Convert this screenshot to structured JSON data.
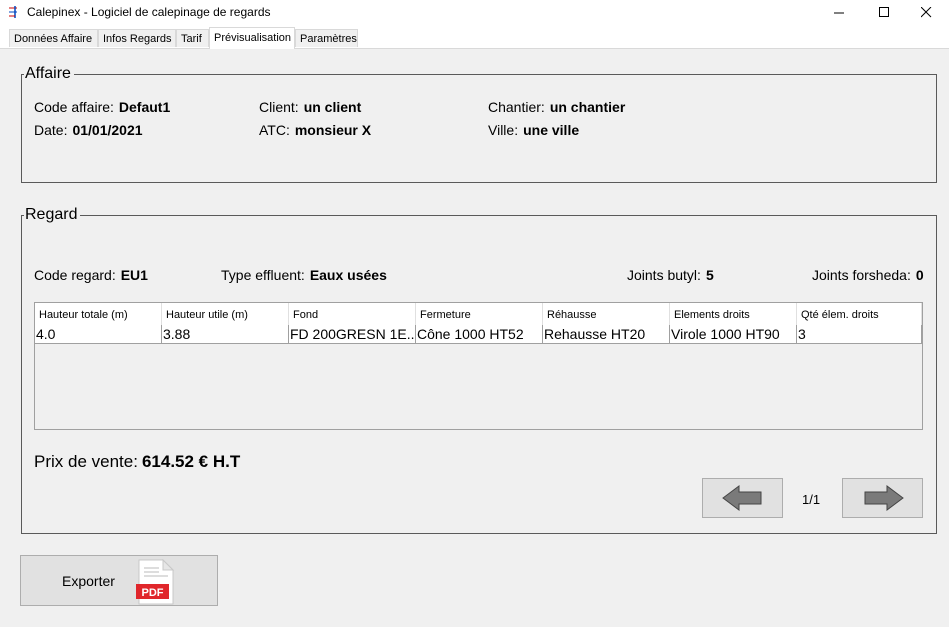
{
  "window": {
    "title": "Calepinex - Logiciel de calepinage de regards"
  },
  "tabs": [
    {
      "label": "Données Affaire"
    },
    {
      "label": "Infos Regards"
    },
    {
      "label": "Tarif"
    },
    {
      "label": "Prévisualisation",
      "active": true
    },
    {
      "label": "Paramètres"
    }
  ],
  "affaire": {
    "legend": "Affaire",
    "code_label": "Code affaire:",
    "code_value": "Defaut1",
    "date_label": "Date:",
    "date_value": "01/01/2021",
    "client_label": "Client:",
    "client_value": "un client",
    "atc_label": "ATC:",
    "atc_value": "monsieur X",
    "chantier_label": "Chantier:",
    "chantier_value": "un chantier",
    "ville_label": "Ville:",
    "ville_value": "une ville"
  },
  "regard": {
    "legend": "Regard",
    "code_label": "Code regard:",
    "code_value": "EU1",
    "effluent_label": "Type effluent:",
    "effluent_value": "Eaux usées",
    "butyl_label": "Joints butyl:",
    "butyl_value": "5",
    "forsheda_label": "Joints forsheda:",
    "forsheda_value": "0",
    "table": {
      "columns": [
        "Hauteur totale (m)",
        "Hauteur utile (m)",
        "Fond",
        "Fermeture",
        "Réhausse",
        "Elements droits",
        "Qté élem. droits"
      ],
      "rows": [
        [
          "4.0",
          "3.88",
          "FD 200GRESN 1E...",
          "Cône 1000 HT52",
          "Rehausse HT20",
          "Virole 1000 HT90",
          "3"
        ]
      ]
    },
    "price_label": "Prix de vente:",
    "price_value": "614.52 € H.T",
    "pagination": "1/1"
  },
  "export": {
    "label": "Exporter",
    "icon_text": "PDF"
  },
  "colors": {
    "pdf_red": "#e0262b",
    "arrow_gray": "#7a7a7a"
  }
}
